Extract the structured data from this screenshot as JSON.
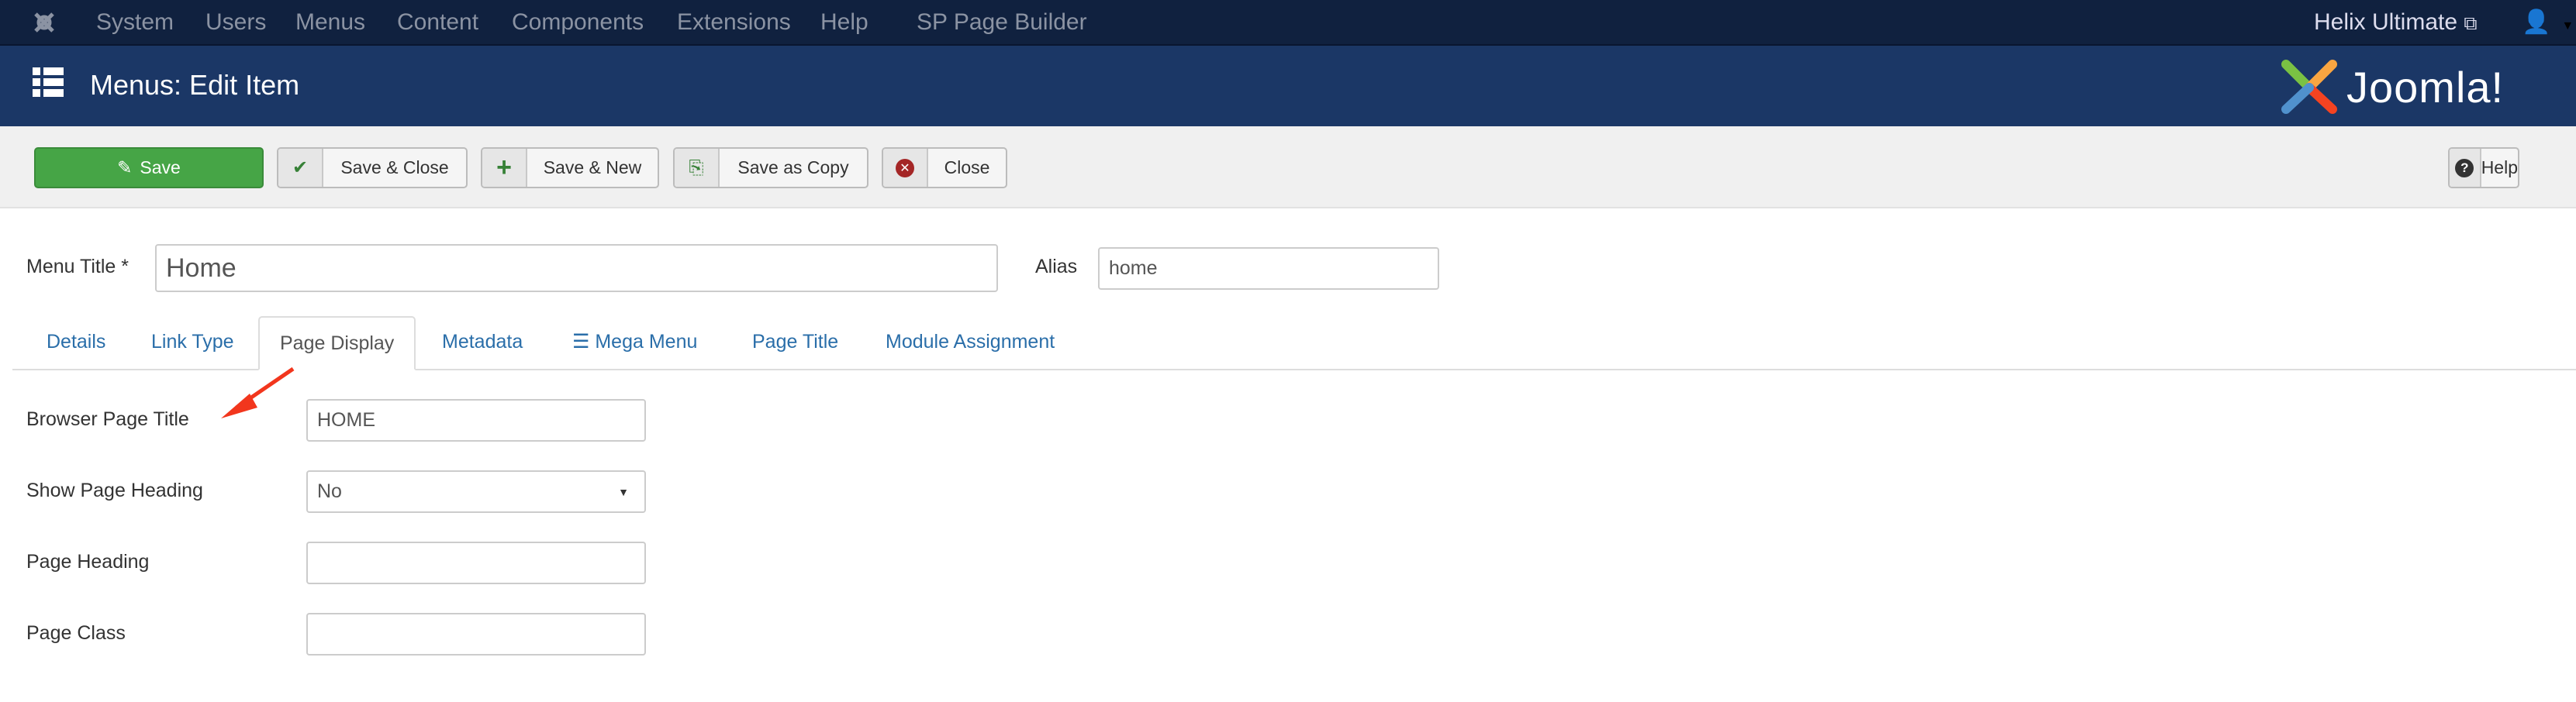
{
  "topbar": {
    "menu": [
      "System",
      "Users",
      "Menus",
      "Content",
      "Components",
      "Extensions",
      "Help",
      "SP Page Builder"
    ],
    "site_link": "Helix Ultimate"
  },
  "header": {
    "title": "Menus: Edit Item",
    "brand": "Joomla!"
  },
  "toolbar": {
    "save": "Save",
    "save_close": "Save & Close",
    "save_new": "Save & New",
    "save_copy": "Save as Copy",
    "close": "Close",
    "help": "Help"
  },
  "form": {
    "menu_title_label": "Menu Title *",
    "menu_title_value": "Home",
    "alias_label": "Alias",
    "alias_value": "home"
  },
  "tabs": [
    "Details",
    "Link Type",
    "Page Display",
    "Metadata",
    "Mega Menu",
    "Page Title",
    "Module Assignment"
  ],
  "active_tab": "Page Display",
  "fields": [
    {
      "label": "Browser Page Title",
      "value": "HOME"
    },
    {
      "label": "Show Page Heading",
      "value": "No"
    },
    {
      "label": "Page Heading",
      "value": ""
    },
    {
      "label": "Page Class",
      "value": ""
    }
  ],
  "colors": {
    "topbar": "#10213f",
    "header": "#1b3766",
    "save": "#46a546",
    "link": "#2a6ea9",
    "annotation_arrow": "#f2361d"
  }
}
